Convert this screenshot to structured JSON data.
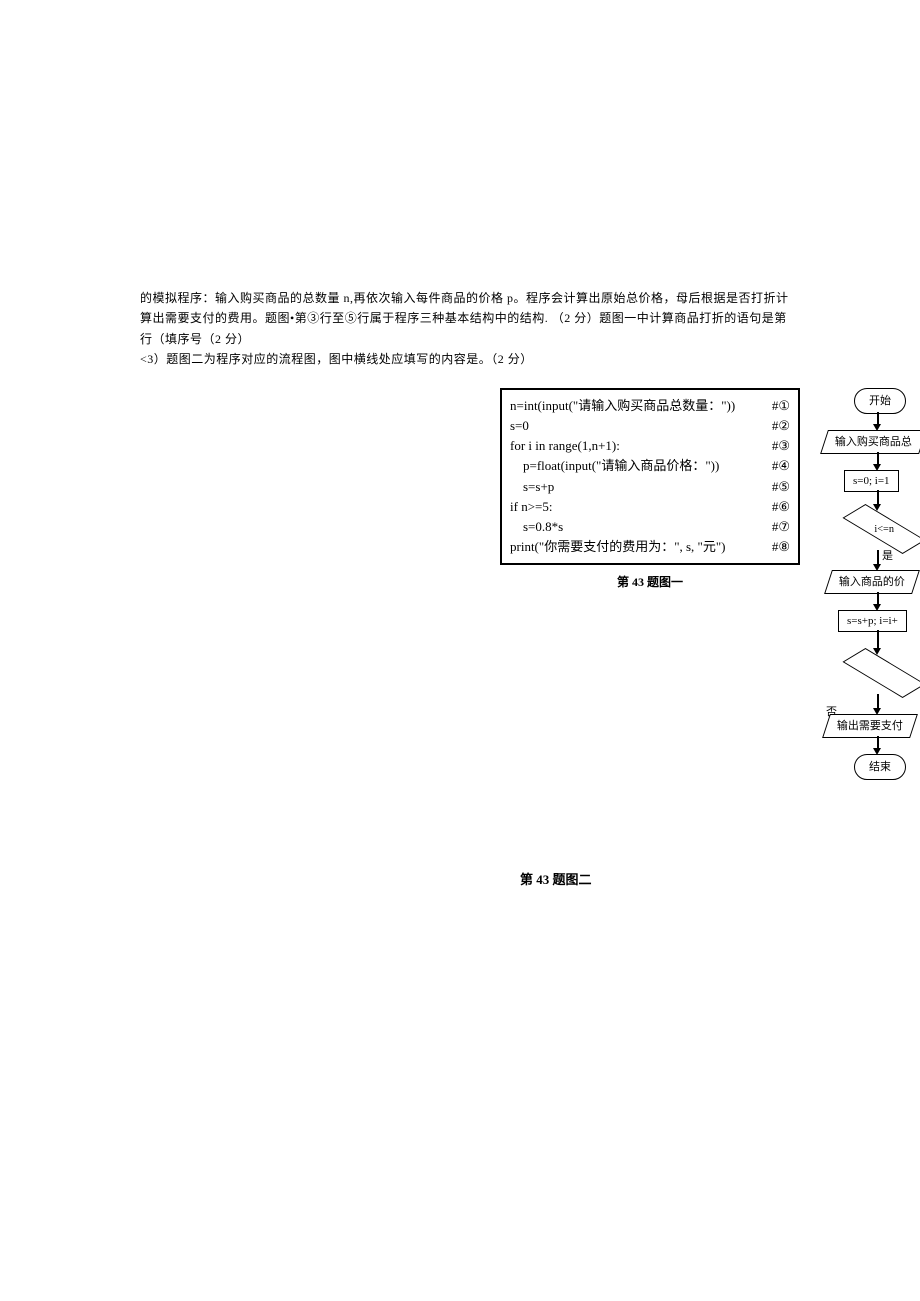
{
  "paragraph": {
    "line1": "的模拟程序：输入购买商品的总数量 n,再依次输入每件商品的价格 p。程序会计算出原始总价格，母后根据是否打折计",
    "line2": "算出需要支付的费用。题图•第③行至⑤行属于程序三种基本结构中的结构. （2 分）题图一中计算商品打折的语句是第",
    "line3": "行（填序号（2 分）",
    "line4": "<3）题图二为程序对应的流程图，图中横线处应填写的内容是。（2 分）"
  },
  "code": {
    "lines": [
      {
        "c": "n=int(input(\"请输入购买商品总数量：\"))",
        "n": "#①"
      },
      {
        "c": "s=0",
        "n": "#②"
      },
      {
        "c": "for i in range(1,n+1):",
        "n": "#③"
      },
      {
        "c": "    p=float(input(\"请输入商品价格：\"))",
        "n": "#④"
      },
      {
        "c": "    s=s+p",
        "n": "#⑤"
      },
      {
        "c": "if n>=5:",
        "n": "#⑥"
      },
      {
        "c": "    s=0.8*s",
        "n": "#⑦"
      },
      {
        "c": "print(\"你需要支付的费用为：\", s, \"元\")",
        "n": "#⑧"
      }
    ],
    "caption": "第 43 题图一"
  },
  "flow": {
    "start": "开始",
    "input_n": "输入购买商品总",
    "init": "s=0; i=1",
    "cond_loop": "i<=n",
    "yes": "是",
    "no": "否",
    "input_p": "输入商品的价",
    "step": "s=s+p; i=i+",
    "output": "输出需要支付",
    "end": "结束",
    "caption": "第 43 题图二"
  }
}
